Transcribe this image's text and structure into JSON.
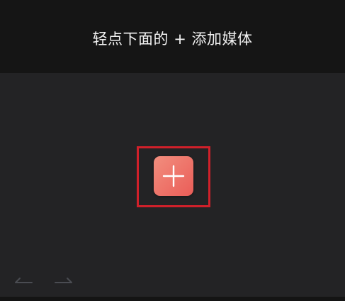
{
  "header": {
    "hint": "轻点下面的 + 添加媒体"
  },
  "main": {
    "add_media_button": {
      "icon": "plus-icon",
      "highlighted": true,
      "highlight_color": "#d0202a",
      "button_color": "#ee7468"
    }
  },
  "toolbar": {
    "undo_icon": "undo-arrow-icon",
    "redo_icon": "redo-arrow-icon"
  },
  "colors": {
    "top_bar": "#151515",
    "canvas": "#232325",
    "icon_muted": "#4a4c52"
  }
}
